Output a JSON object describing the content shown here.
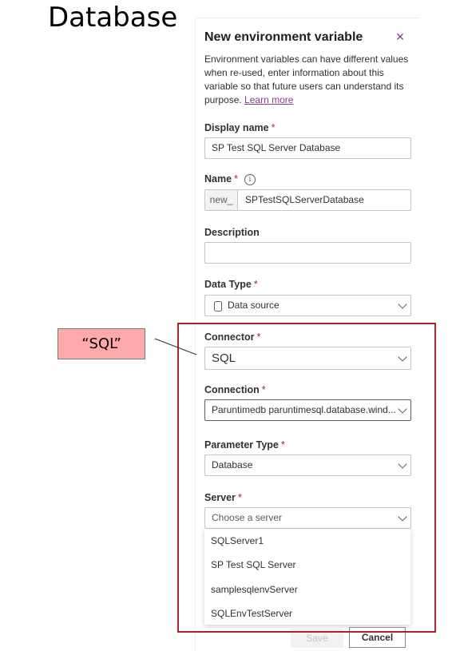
{
  "page_title": "Database",
  "panel": {
    "title": "New environment variable",
    "close_glyph": "×",
    "description": "Environment variables can have different values when re-used, enter information about this variable so that future users can understand its purpose.",
    "learn_more": "Learn more"
  },
  "fields": {
    "display_name": {
      "label": "Display name",
      "value": "SP Test SQL Server Database"
    },
    "name": {
      "label": "Name",
      "prefix": "new_",
      "value": "SPTestSQLServerDatabase",
      "info_glyph": "i"
    },
    "description": {
      "label": "Description",
      "value": ""
    },
    "data_type": {
      "label": "Data Type",
      "value": "Data source",
      "icon": "database-icon"
    },
    "connector": {
      "label": "Connector",
      "value": "SQL"
    },
    "connection": {
      "label": "Connection",
      "value": "Paruntimedb paruntimesql.database.wind..."
    },
    "parameter_type": {
      "label": "Parameter Type",
      "value": "Database"
    },
    "server": {
      "label": "Server",
      "placeholder": "Choose a server"
    }
  },
  "required_marker": "*",
  "server_options": [
    "SQLServer1",
    "SP Test SQL Server",
    "samplesqlenvServer",
    "SQLEnvTestServer"
  ],
  "buttons": {
    "save": "Save",
    "cancel": "Cancel"
  },
  "callout": {
    "text": "“SQL”"
  },
  "colors": {
    "accent": "#8a3b8f",
    "highlight": "#a4262c",
    "callout_bg": "#ffaaaa"
  }
}
